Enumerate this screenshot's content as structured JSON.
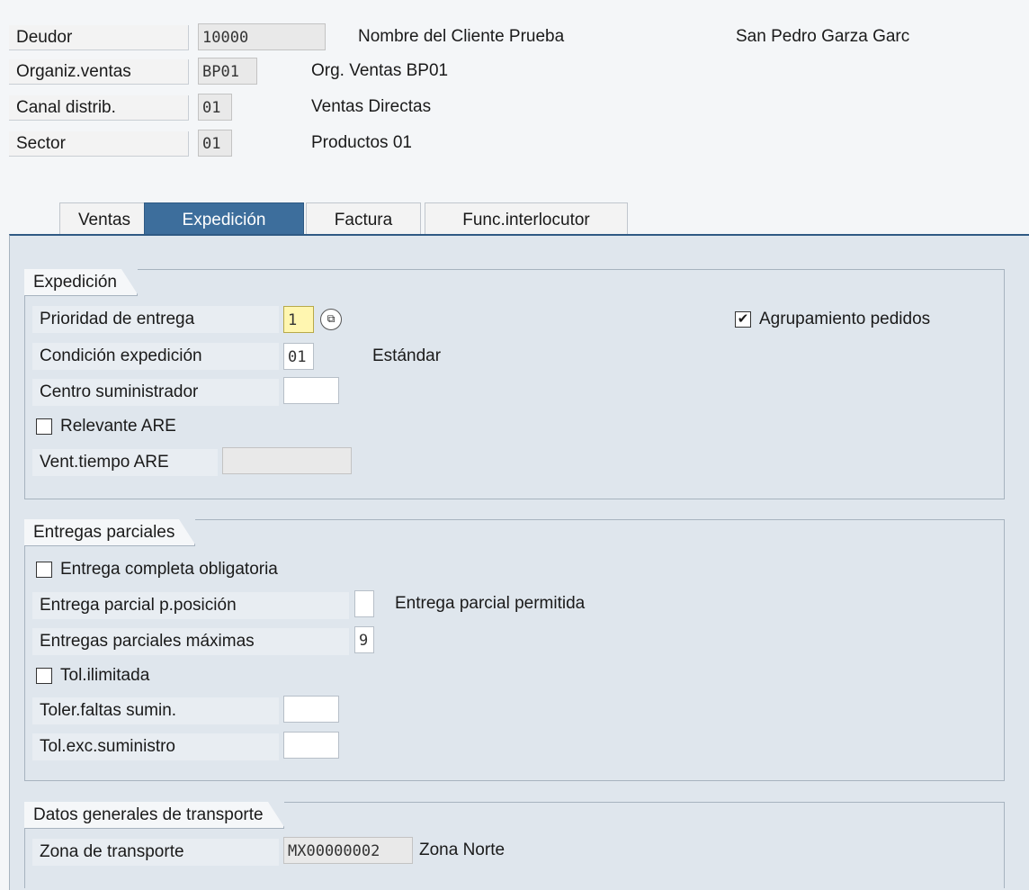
{
  "header": {
    "deudor": {
      "label": "Deudor",
      "value": "10000",
      "name": "Nombre del Cliente Prueba",
      "city": "San Pedro Garza Garc"
    },
    "org_ventas": {
      "label": "Organiz.ventas",
      "value": "BP01",
      "desc": "Org. Ventas BP01"
    },
    "canal": {
      "label": "Canal distrib.",
      "value": "01",
      "desc": "Ventas Directas"
    },
    "sector": {
      "label": "Sector",
      "value": "01",
      "desc": "Productos 01"
    }
  },
  "tabs": [
    {
      "label": "Ventas",
      "active": false
    },
    {
      "label": "Expedición",
      "active": true
    },
    {
      "label": "Factura",
      "active": false
    },
    {
      "label": "Func.interlocutor",
      "active": false
    }
  ],
  "expedicion": {
    "title": "Expedición",
    "prioridad": {
      "label": "Prioridad de entrega",
      "value": "1"
    },
    "agrupamiento": {
      "label": "Agrupamiento pedidos",
      "checked": true
    },
    "condicion": {
      "label": "Condición expedición",
      "value": "01",
      "desc": "Estándar"
    },
    "centro": {
      "label": "Centro suministrador",
      "value": ""
    },
    "relevante": {
      "label": "Relevante ARE",
      "checked": false
    },
    "vent_tiempo": {
      "label": "Vent.tiempo ARE",
      "value": ""
    }
  },
  "entregas": {
    "title": "Entregas parciales",
    "completa": {
      "label": "Entrega completa obligatoria",
      "checked": false
    },
    "parcial_pos": {
      "label": "Entrega parcial p.posición",
      "value": "",
      "desc": "Entrega parcial permitida"
    },
    "maximas": {
      "label": "Entregas parciales máximas",
      "value": "9"
    },
    "tol_ilimitada": {
      "label": "Tol.ilimitada",
      "checked": false
    },
    "toler_faltas": {
      "label": "Toler.faltas sumin.",
      "value": ""
    },
    "tol_exc": {
      "label": "Tol.exc.suministro",
      "value": ""
    }
  },
  "transporte": {
    "title": "Datos generales de transporte",
    "zona": {
      "label": "Zona de transporte",
      "value": "MX00000002",
      "desc": "Zona Norte"
    }
  },
  "icons": {
    "checkmark": "✔",
    "f4_help": "⧉"
  }
}
